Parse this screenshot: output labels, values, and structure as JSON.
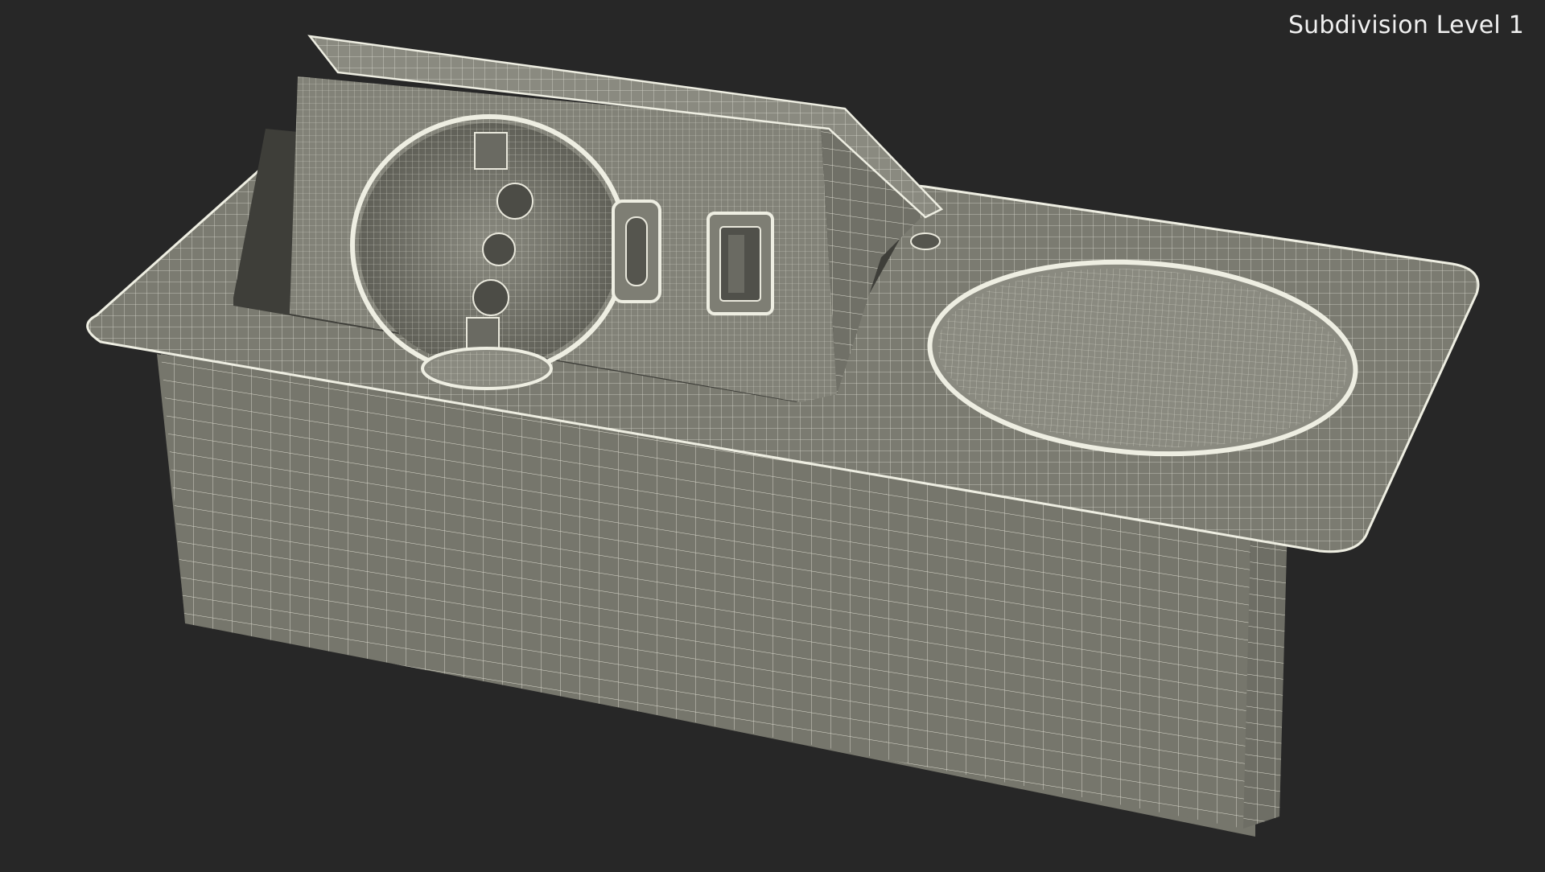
{
  "render_label": "Subdivision Level 1",
  "colors": {
    "background": "#272727",
    "surface": "#76766c",
    "surface_light": "#8a8a80",
    "surface_dark": "#5f5f57",
    "wire": "#e9e8dc"
  }
}
